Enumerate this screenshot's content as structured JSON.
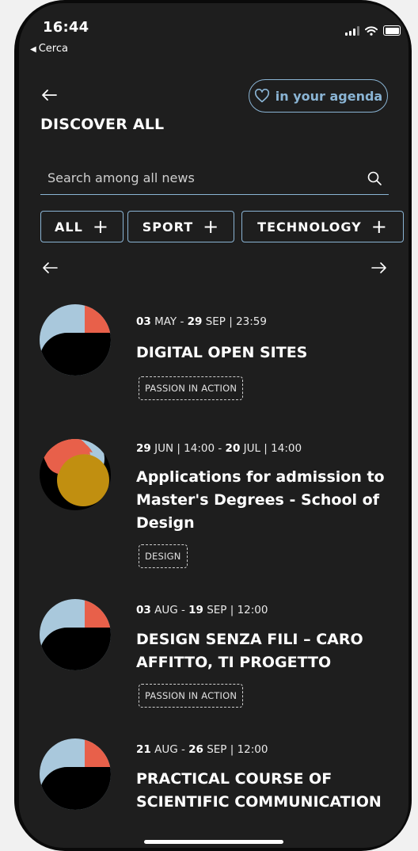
{
  "status_bar": {
    "time": "16:44",
    "back_app": "Cerca"
  },
  "header": {
    "title": "DISCOVER ALL",
    "agenda_button": "in your agenda"
  },
  "search": {
    "placeholder": "Search among all news"
  },
  "filters": [
    {
      "label": "ALL"
    },
    {
      "label": "SPORT"
    },
    {
      "label": "TECHNOLOGY"
    }
  ],
  "events": [
    {
      "date_start_day": "03",
      "date_start_rest": " MAY - ",
      "date_end_day": "29",
      "date_end_rest": " SEP | 23:59",
      "title": "DIGITAL OPEN SITES",
      "tag": "PASSION IN ACTION",
      "thumb": "blue-orange-black"
    },
    {
      "date_start_day": "29",
      "date_start_rest": " JUN | 14:00 - ",
      "date_end_day": "20",
      "date_end_rest": " JUL | 14:00",
      "title": "Applications for admission to Master's Degrees - School of Design",
      "tag": "DESIGN",
      "thumb": "orange-gold-black"
    },
    {
      "date_start_day": "03",
      "date_start_rest": " AUG - ",
      "date_end_day": "19",
      "date_end_rest": " SEP | 12:00",
      "title": "DESIGN SENZA FILI – CARO AFFITTO, TI PROGETTO",
      "tag": "PASSION IN ACTION",
      "thumb": "blue-orange-black"
    },
    {
      "date_start_day": "21",
      "date_start_rest": " AUG - ",
      "date_end_day": "26",
      "date_end_rest": " SEP | 12:00",
      "title": "PRACTICAL COURSE OF SCIENTIFIC COMMUNICATION",
      "tag": "",
      "thumb": "blue-orange-black"
    }
  ],
  "colors": {
    "background": "#1e1e1e",
    "accent": "#8ab4d4",
    "thumb_blue": "#a9c8dc",
    "thumb_orange": "#e8604a",
    "thumb_gold": "#c18f10"
  },
  "icons": [
    "back-arrow-icon",
    "heart-icon",
    "search-icon",
    "plus-icon",
    "arrow-left-icon",
    "arrow-right-icon"
  ]
}
